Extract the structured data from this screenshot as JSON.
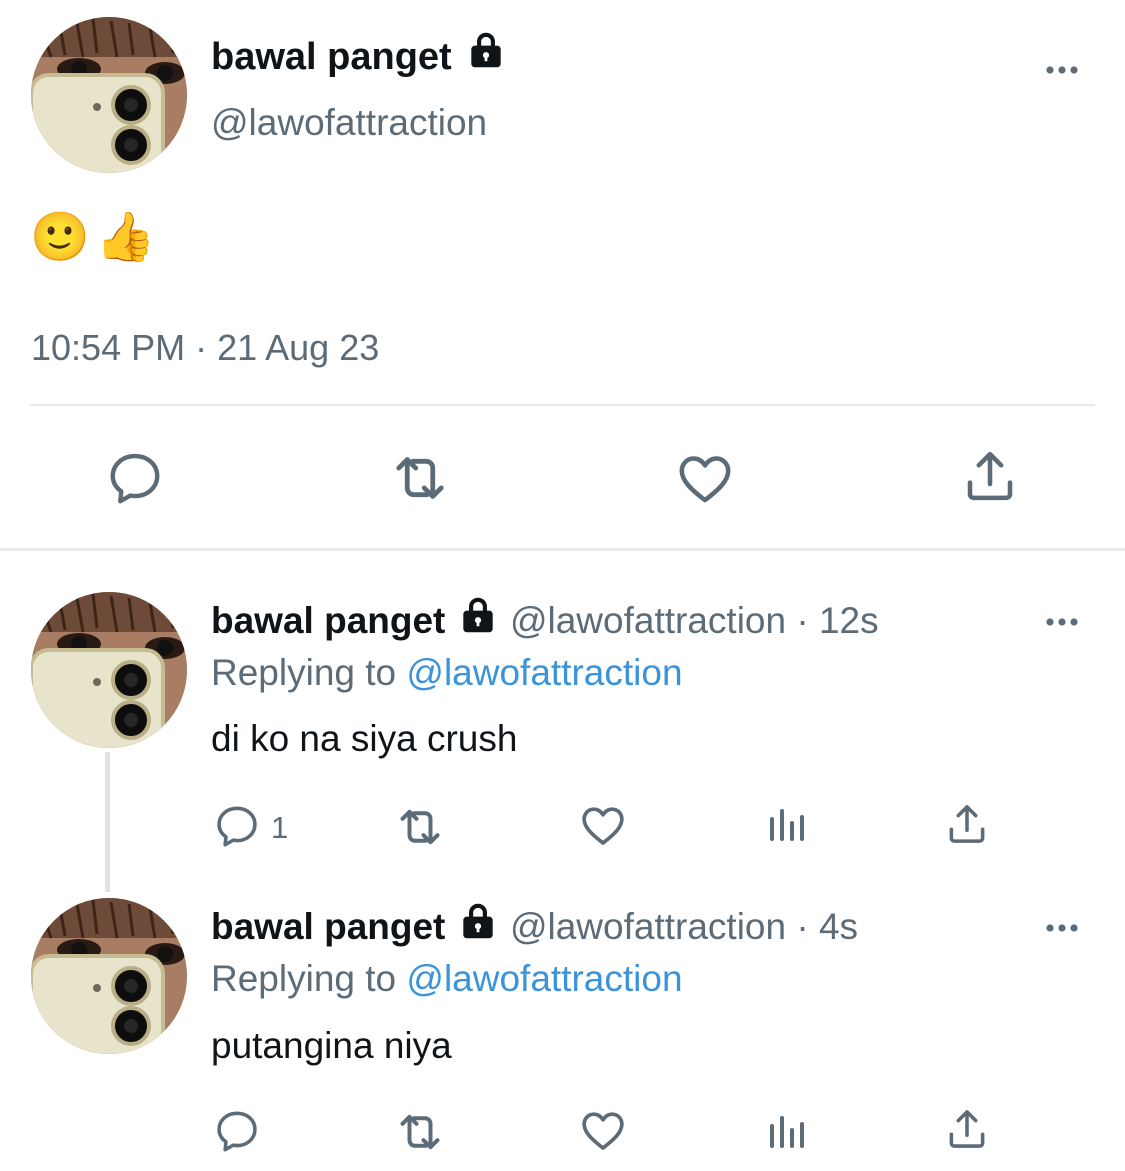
{
  "main_tweet": {
    "display_name": "bawal panget",
    "handle": "@lawofattraction",
    "content": "🙂👍",
    "timestamp": "10:54 PM · 21 Aug 23",
    "icons": [
      "reply-icon",
      "retweet-icon",
      "like-icon",
      "share-icon"
    ]
  },
  "replies": [
    {
      "display_name": "bawal panget",
      "handle": "@lawofattraction",
      "separator": "·",
      "time": "12s",
      "replying_label": "Replying to",
      "replying_to": "@lawofattraction",
      "text": "di ko na siya crush",
      "reply_count": "1",
      "icons": [
        "reply-icon",
        "retweet-icon",
        "like-icon",
        "views-icon",
        "share-icon"
      ]
    },
    {
      "display_name": "bawal panget",
      "handle": "@lawofattraction",
      "separator": "·",
      "time": "4s",
      "replying_label": "Replying to",
      "replying_to": "@lawofattraction",
      "text": "putangina niya",
      "reply_count": "",
      "icons": [
        "reply-icon",
        "retweet-icon",
        "like-icon",
        "views-icon",
        "share-icon"
      ]
    }
  ],
  "colors": {
    "text": "#0f1419",
    "secondary": "#5b6b78",
    "link": "#3b94d9",
    "divider": "#e6e9eb"
  }
}
